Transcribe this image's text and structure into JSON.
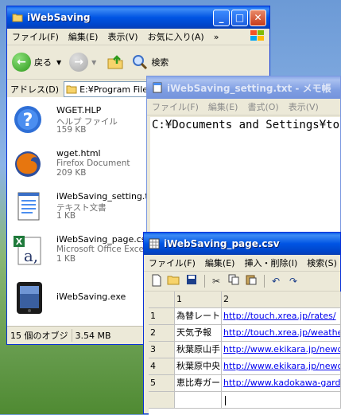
{
  "explorer": {
    "title": "iWebSaving",
    "menu": [
      "ファイル(F)",
      "編集(E)",
      "表示(V)",
      "お気に入り(A)",
      "»"
    ],
    "toolbar": {
      "back_label": "戻る",
      "search_label": "検索"
    },
    "address": {
      "label": "アドレス(D)",
      "value": "E:¥Program Files"
    },
    "files": [
      {
        "name": "WGET.HLP",
        "type": "ヘルプ ファイル",
        "size": "159 KB",
        "icon": "help-file-icon"
      },
      {
        "name": "wget.html",
        "type": "Firefox Document",
        "size": "209 KB",
        "icon": "firefox-icon"
      },
      {
        "name": "iWebSaving_setting.txt",
        "type": "テキスト文書",
        "size": "1 KB",
        "icon": "text-file-icon"
      },
      {
        "name": "iWebSaving_page.csv",
        "type": "Microsoft Office Excel",
        "size": "1 KB",
        "icon": "excel-csv-icon"
      },
      {
        "name": "iWebSaving.exe",
        "type": "",
        "size": "",
        "icon": "ipod-app-icon"
      }
    ],
    "status": {
      "objects": "15 個のオブジ",
      "size": "3.54 MB"
    }
  },
  "notepad": {
    "title": "iWebSaving_setting.txt - メモ帳",
    "menu": [
      "ファイル(F)",
      "編集(E)",
      "書式(O)",
      "表示(V)"
    ],
    "content": "C:¥Documents and Settings¥tok"
  },
  "csv": {
    "title": "iWebSaving_page.csv",
    "menu": [
      "ファイル(F)",
      "編集(E)",
      "挿入・削除(I)",
      "検索(S)"
    ],
    "col_headers": [
      "",
      "1",
      "2"
    ],
    "rows": [
      {
        "num": "1",
        "name": "為替レート",
        "url": "http://touch.xrea.jp/rates/"
      },
      {
        "num": "2",
        "name": "天気予報",
        "url": "http://touch.xrea.jp/weathe"
      },
      {
        "num": "3",
        "name": "秋葉原山手",
        "url": "http://www.ekikara.jp/newd"
      },
      {
        "num": "4",
        "name": "秋葉原中央",
        "url": "http://www.ekikara.jp/newd"
      },
      {
        "num": "5",
        "name": "恵比寿ガー",
        "url": "http://www.kadokawa-gard"
      },
      {
        "num": "",
        "name": "",
        "url": ""
      }
    ]
  }
}
